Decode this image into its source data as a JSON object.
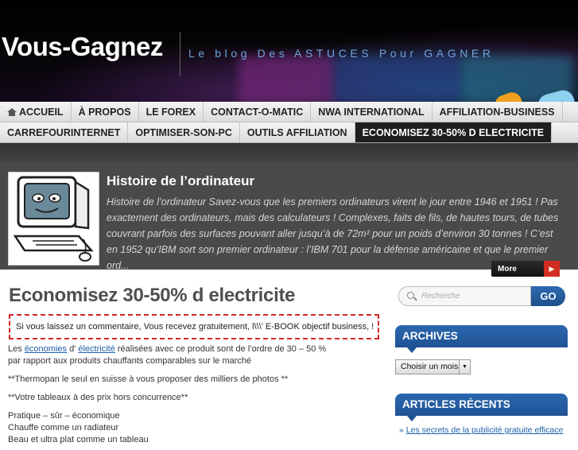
{
  "header": {
    "logo": "Vous-Gagnez",
    "tagline": "Le blog Des ASTUCES Pour GAGNER"
  },
  "nav": {
    "row1": [
      "ACCUEIL",
      "À PROPOS",
      "LE FOREX",
      "CONTACT-O-MATIC",
      "NWA INTERNATIONAL",
      "AFFILIATION-BUSINESS"
    ],
    "row2": [
      "CARREFOURINTERNET",
      "OPTIMISER-SON-PC",
      "OUTILS AFFILIATION",
      "ECONOMISEZ 30-50% D ELECTRICITE"
    ]
  },
  "featured": {
    "title": "Histoire de l’ordinateur",
    "text": "Histoire de l’ordinateur Savez-vous que les premiers ordinateurs virent le jour entre 1946 et 1951 ! Pas exactement des ordinateurs, mais des calculateurs ! Complexes, faits de fils, de hautes tours, de tubes couvrant parfois des surfaces pouvant aller jusqu’à de 72m² pour un poids d’environ 30 tonnes ! C’est en 1952 qu’IBM sort son premier ordinateur : l’IBM 701 pour la défense américaine et que le premier ord...",
    "more_label": "More",
    "more_arrow": "▶"
  },
  "post": {
    "title": "Economisez 30-50% d electricite",
    "notice": "Si vous laissez un commentaire, Vous recevez gratuitement, l\\\\\\' E-BOOK objectif business, !",
    "p1_pre": "Les",
    "p1_link1": "économies",
    "p1_mid": "d'",
    "p1_link2": "électricité",
    "p1_post": "réalisées avec ce produit sont de l’ordre de 30 – 50 %",
    "p1_line2": "par rapport aux produits chauffants comparables sur le marché",
    "p2": "**Thermopan le seul en suisse à vous proposer des milliers de photos **",
    "p3": "**Votre tableaux à des prix hors concurrence**",
    "list1": "Pratique – sûr – économique",
    "list2": "Chauffe comme un radiateur",
    "list3": "Beau et ultra plat comme un tableau"
  },
  "sidebar": {
    "search_placeholder": "Recherche",
    "go_label": "GO",
    "archives_title": "ARCHIVES",
    "archives_select": "Choisir un mois",
    "recent_title": "ARTICLES RÉCENTS",
    "recent_item": "Les secrets de la publicité gratuite efficace"
  },
  "colors": {
    "accent_blue": "#1f5293",
    "notice_red": "#d92626",
    "link": "#1d5fa8"
  }
}
